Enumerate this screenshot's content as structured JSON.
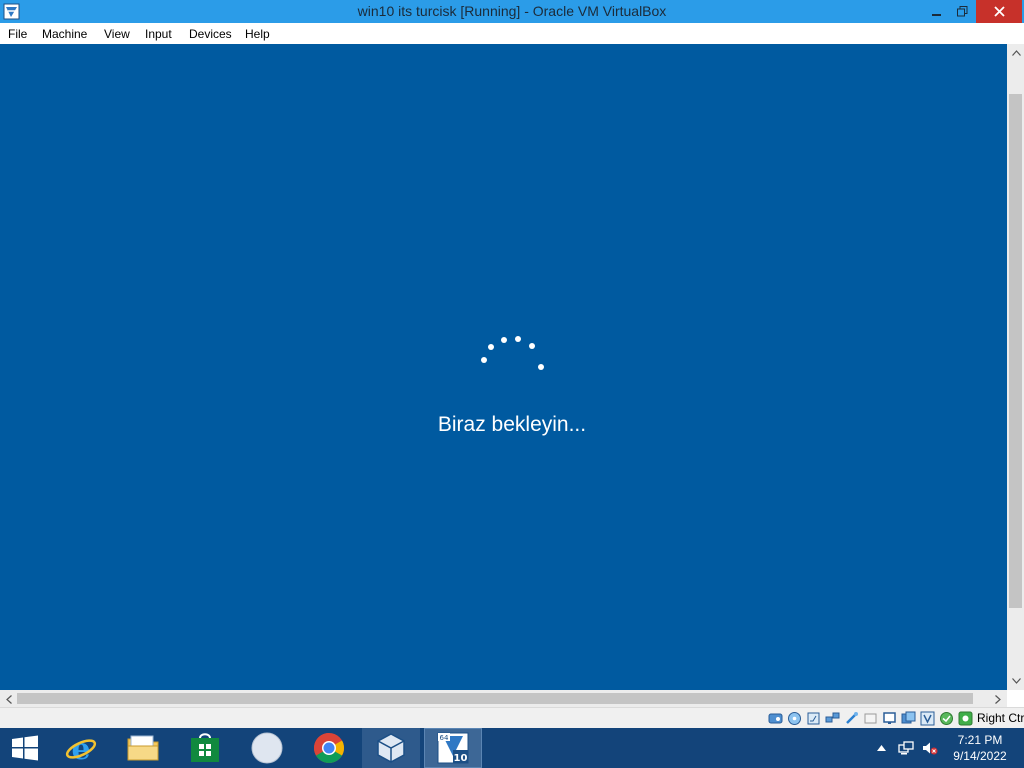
{
  "window": {
    "title": "win10 its turcisk [Running] - Oracle VM VirtualBox"
  },
  "menu": {
    "items": [
      "File",
      "Machine",
      "View",
      "Input",
      "Devices",
      "Help"
    ]
  },
  "vm_screen": {
    "message": "Biraz bekleyin...",
    "background_color": "#005aa0"
  },
  "statusbar": {
    "icons": [
      "hard-disk-icon",
      "optical-drive-icon",
      "audio-icon",
      "network-icon",
      "usb-icon",
      "shared-folders-icon",
      "display-icon",
      "video-capture-icon",
      "virtualization-icon",
      "cpu-icon",
      "mouse-integration-icon"
    ],
    "host_key": "Right Ctrl"
  },
  "taskbar": {
    "apps": [
      "start-button",
      "internet-explorer",
      "file-explorer",
      "store",
      "app-circle",
      "chrome",
      "virtualbox-manager",
      "virtualbox-vm-win10"
    ],
    "clock_time": "7:21 PM",
    "clock_date": "9/14/2022"
  },
  "colors": {
    "titlebar": "#2b9ce8",
    "close_button": "#c7312a",
    "taskbar": "#13447a"
  }
}
